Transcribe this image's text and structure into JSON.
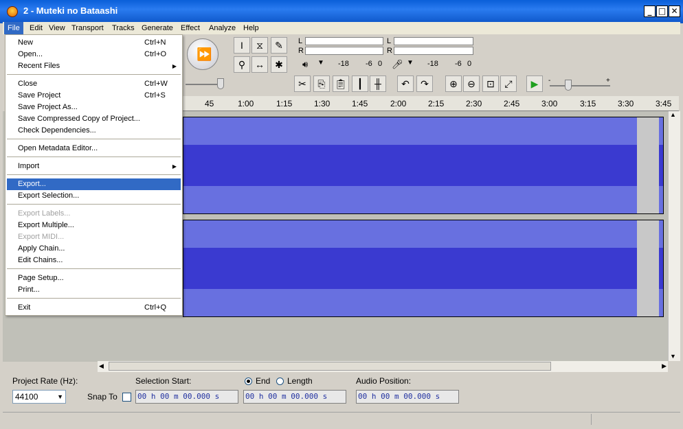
{
  "window": {
    "title": "2 - Muteki no Bataashi",
    "minimize": "_",
    "maximize": "□",
    "close": "✕"
  },
  "menubar": [
    "File",
    "Edit",
    "View",
    "Transport",
    "Tracks",
    "Generate",
    "Effect",
    "Analyze",
    "Help"
  ],
  "file_menu": [
    {
      "label": "New",
      "shortcut": "Ctrl+N"
    },
    {
      "label": "Open...",
      "shortcut": "Ctrl+O"
    },
    {
      "label": "Recent Files",
      "submenu": true
    },
    {
      "sep": true
    },
    {
      "label": "Close",
      "shortcut": "Ctrl+W"
    },
    {
      "label": "Save Project",
      "shortcut": "Ctrl+S"
    },
    {
      "label": "Save Project As..."
    },
    {
      "label": "Save Compressed Copy of Project..."
    },
    {
      "label": "Check Dependencies..."
    },
    {
      "sep": true
    },
    {
      "label": "Open Metadata Editor..."
    },
    {
      "sep": true
    },
    {
      "label": "Import",
      "submenu": true
    },
    {
      "sep": true
    },
    {
      "label": "Export...",
      "highlighted": true
    },
    {
      "label": "Export Selection..."
    },
    {
      "sep": true
    },
    {
      "label": "Export Labels...",
      "disabled": true
    },
    {
      "label": "Export Multiple..."
    },
    {
      "label": "Export MIDI...",
      "disabled": true
    },
    {
      "label": "Apply Chain..."
    },
    {
      "label": "Edit Chains..."
    },
    {
      "sep": true
    },
    {
      "label": "Page Setup..."
    },
    {
      "label": "Print..."
    },
    {
      "sep": true
    },
    {
      "label": "Exit",
      "shortcut": "Ctrl+Q"
    }
  ],
  "meters": {
    "L": "L",
    "R": "R",
    "play_ticks": [
      "-18",
      "-6",
      "0"
    ],
    "rec_ticks": [
      "-18",
      "-6",
      "0"
    ]
  },
  "timeline": [
    "45",
    "1:00",
    "1:15",
    "1:30",
    "1:45",
    "2:00",
    "2:15",
    "2:30",
    "2:45",
    "3:00",
    "3:15",
    "3:30",
    "3:45"
  ],
  "bottom": {
    "project_rate_label": "Project Rate (Hz):",
    "project_rate_value": "44100",
    "snap_to": "Snap To",
    "selection_start_label": "Selection Start:",
    "end_label": "End",
    "length_label": "Length",
    "audio_position_label": "Audio Position:",
    "time_value": "00 h 00 m 00.000 s"
  },
  "colors": {
    "waveform": "#3a3ad0",
    "waveform_light": "#6870e0",
    "highlight": "#316ac5",
    "titlebar": "#0a5fd8"
  }
}
